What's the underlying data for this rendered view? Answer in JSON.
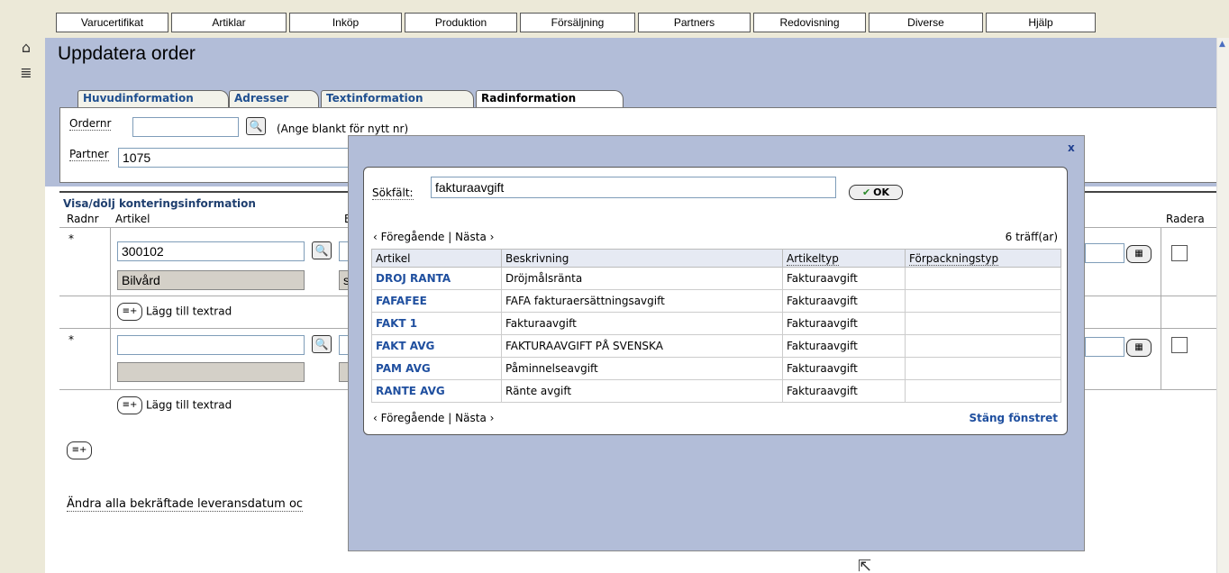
{
  "topmenu": {
    "items": [
      "Varucertifikat",
      "Artiklar",
      "Inköp",
      "Produktion",
      "Försäljning",
      "Partners",
      "Redovisning",
      "Diverse",
      "Hjälp"
    ]
  },
  "leftrail": {
    "icons": [
      "home-icon",
      "list-icon"
    ]
  },
  "page": {
    "title": "Uppdatera order"
  },
  "tabs": [
    "Huvudinformation",
    "Adresser",
    "Textinformation",
    "Radinformation"
  ],
  "form": {
    "ordernr_label": "Ordernr",
    "ordernr_value": "",
    "ordernr_hint": "(Ange blankt för nytt nr)",
    "partner_label": "Partner",
    "partner_value": "1075"
  },
  "orderlist": {
    "toggle_label": "Visa/dölj konteringsinformation",
    "col_radnr": "Radnr",
    "col_artikel": "Artikel",
    "col_b": "B",
    "col_radera": "Radera",
    "rows": [
      {
        "marker": "*",
        "artikel": "300102",
        "desc": "Bilvård",
        "desc2": "s",
        "addtext": "Lägg till textrad"
      },
      {
        "marker": "*",
        "artikel": "",
        "desc": "",
        "desc2": "",
        "addtext": "Lägg till textrad"
      }
    ],
    "change_all_text": "Ändra alla bekräftade leveransdatum oc"
  },
  "dialog": {
    "close": "x",
    "search_label": "Sökfält:",
    "search_value": "fakturaavgift",
    "ok_label": "OK",
    "prev": "‹ Föregående",
    "sep": "|",
    "next": "Nästa ›",
    "hits": "6 träff(ar)",
    "columns": [
      "Artikel",
      "Beskrivning",
      "Artikeltyp",
      "Förpackningstyp"
    ],
    "results": [
      {
        "artikel": "DROJ RANTA",
        "beskrivning": "Dröjmålsränta",
        "artikeltyp": "Fakturaavgift",
        "forpackningstyp": ""
      },
      {
        "artikel": "FAFAFEE",
        "beskrivning": "FAFA fakturaersättningsavgift",
        "artikeltyp": "Fakturaavgift",
        "forpackningstyp": ""
      },
      {
        "artikel": "FAKT 1",
        "beskrivning": "Fakturaavgift",
        "artikeltyp": "Fakturaavgift",
        "forpackningstyp": ""
      },
      {
        "artikel": "FAKT AVG",
        "beskrivning": "FAKTURAAVGIFT PÅ SVENSKA",
        "artikeltyp": "Fakturaavgift",
        "forpackningstyp": ""
      },
      {
        "artikel": "PAM AVG",
        "beskrivning": "Påminnelseavgift",
        "artikeltyp": "Fakturaavgift",
        "forpackningstyp": ""
      },
      {
        "artikel": "RANTE AVG",
        "beskrivning": "Ränte avgift",
        "artikeltyp": "Fakturaavgift",
        "forpackningstyp": ""
      }
    ],
    "close_window": "Stäng fönstret"
  }
}
